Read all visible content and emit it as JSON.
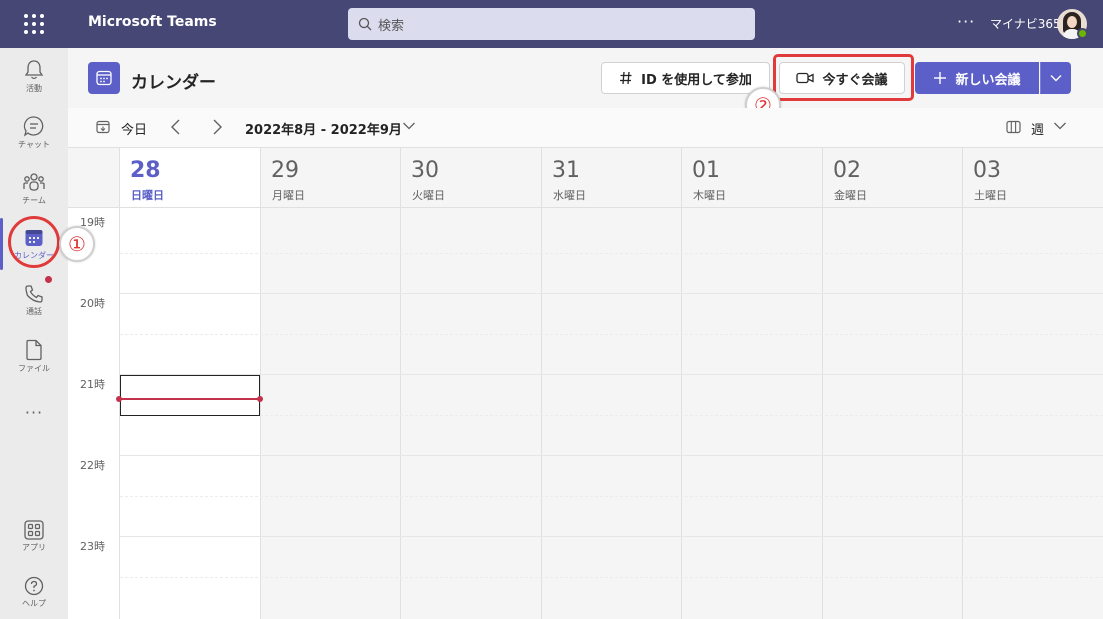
{
  "app": {
    "title": "Microsoft Teams",
    "search_placeholder": "検索",
    "more": "···",
    "org": "マイナビ365"
  },
  "rail": {
    "items": [
      {
        "label": "活動",
        "icon": "bell-icon"
      },
      {
        "label": "チャット",
        "icon": "chat-icon"
      },
      {
        "label": "チーム",
        "icon": "teams-icon"
      },
      {
        "label": "カレンダー",
        "icon": "calendar-icon"
      },
      {
        "label": "通話",
        "icon": "phone-icon"
      },
      {
        "label": "ファイル",
        "icon": "file-icon"
      },
      {
        "label": "···",
        "icon": "more-icon"
      },
      {
        "label": "アプリ",
        "icon": "apps-icon"
      },
      {
        "label": "ヘルプ",
        "icon": "help-icon"
      }
    ]
  },
  "header": {
    "title": "カレンダー",
    "join_id": "ID を使用して参加",
    "meet_now": "今すぐ会議",
    "new_meeting": "新しい会議"
  },
  "annotations": {
    "one": "①",
    "two": "②"
  },
  "toolbar": {
    "today": "今日",
    "range": "2022年8月 - 2022年9月",
    "view": "週"
  },
  "days": [
    {
      "num": "28",
      "name": "日曜日"
    },
    {
      "num": "29",
      "name": "月曜日"
    },
    {
      "num": "30",
      "name": "火曜日"
    },
    {
      "num": "31",
      "name": "水曜日"
    },
    {
      "num": "01",
      "name": "木曜日"
    },
    {
      "num": "02",
      "name": "金曜日"
    },
    {
      "num": "03",
      "name": "土曜日"
    }
  ],
  "hours": [
    "19時",
    "20時",
    "21時",
    "22時",
    "23時"
  ],
  "colors": {
    "brand": "#464775",
    "accent": "#5b5fc7",
    "now": "#c4314b",
    "highlight": "#e03a3a"
  }
}
